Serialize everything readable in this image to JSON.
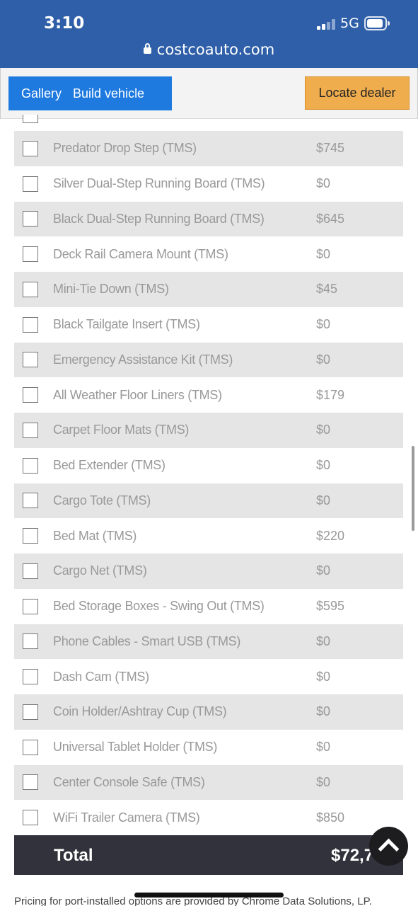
{
  "status_bar": {
    "time": "3:10",
    "network": "5G"
  },
  "browser": {
    "url": "costcoauto.com"
  },
  "nav": {
    "gallery": "Gallery",
    "build": "Build vehicle",
    "locate": "Locate dealer"
  },
  "options": [
    {
      "name": "Predator Drop Step (TMS)",
      "price": "$745"
    },
    {
      "name": "Silver Dual-Step Running Board (TMS)",
      "price": "$0"
    },
    {
      "name": "Black Dual-Step Running Board (TMS)",
      "price": "$645"
    },
    {
      "name": "Deck Rail Camera Mount (TMS)",
      "price": "$0"
    },
    {
      "name": "Mini-Tie Down (TMS)",
      "price": "$45"
    },
    {
      "name": "Black Tailgate Insert (TMS)",
      "price": "$0"
    },
    {
      "name": "Emergency Assistance Kit (TMS)",
      "price": "$0"
    },
    {
      "name": "All Weather Floor Liners (TMS)",
      "price": "$179"
    },
    {
      "name": "Carpet Floor Mats (TMS)",
      "price": "$0"
    },
    {
      "name": "Bed Extender (TMS)",
      "price": "$0"
    },
    {
      "name": "Cargo Tote (TMS)",
      "price": "$0"
    },
    {
      "name": "Bed Mat (TMS)",
      "price": "$220"
    },
    {
      "name": "Cargo Net (TMS)",
      "price": "$0"
    },
    {
      "name": "Bed Storage Boxes - Swing Out (TMS)",
      "price": "$595"
    },
    {
      "name": "Phone Cables - Smart USB (TMS)",
      "price": "$0"
    },
    {
      "name": "Dash Cam (TMS)",
      "price": "$0"
    },
    {
      "name": "Coin Holder/Ashtray Cup (TMS)",
      "price": "$0"
    },
    {
      "name": "Universal Tablet Holder (TMS)",
      "price": "$0"
    },
    {
      "name": "Center Console Safe (TMS)",
      "price": "$0"
    },
    {
      "name": "WiFi Trailer Camera (TMS)",
      "price": "$850"
    }
  ],
  "total": {
    "label": "Total",
    "value": "$72,7"
  },
  "footer": {
    "text": "Pricing for port-installed options are provided by Chrome Data Solutions, LP."
  },
  "colors": {
    "header_bg": "#2f5fa8",
    "nav_btn": "#1f7ae0",
    "locate_btn": "#f0ad4e",
    "total_bg": "#32323c"
  }
}
